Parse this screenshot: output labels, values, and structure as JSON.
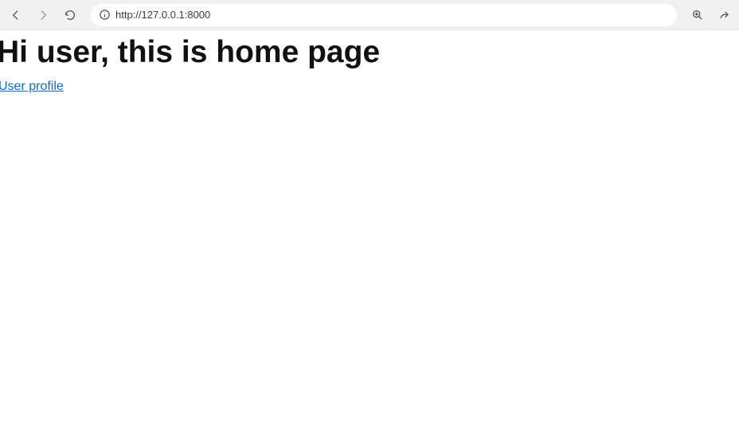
{
  "browser": {
    "url": "http://127.0.0.1:8000"
  },
  "page": {
    "heading": "Hi user, this is home page",
    "profile_link_text": "User profile"
  }
}
